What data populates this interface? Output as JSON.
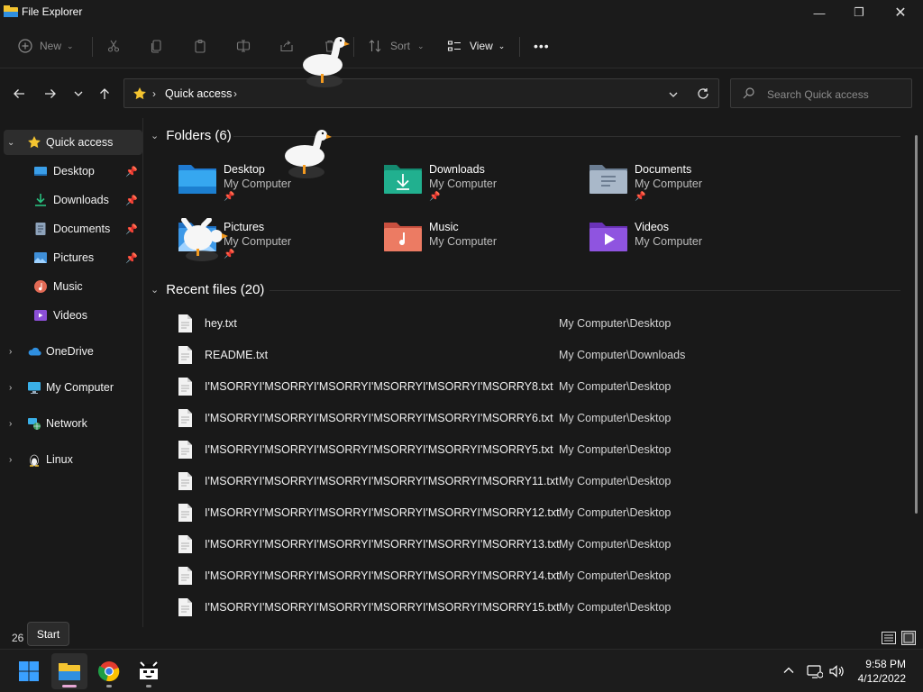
{
  "window": {
    "title": "File Explorer",
    "controls": {
      "minimize": "—",
      "maximize": "❐",
      "close": "✕"
    }
  },
  "commandbar": {
    "new_label": "New",
    "sort_label": "Sort",
    "view_label": "View",
    "more_label": "•••"
  },
  "address": {
    "chevron": "›",
    "location": "Quick access",
    "trailing_chevron": "›",
    "search_placeholder": "Search Quick access"
  },
  "sidebar": {
    "quick_access": "Quick access",
    "items": [
      {
        "label": "Desktop",
        "pinned": true,
        "icon": "desktop-icon"
      },
      {
        "label": "Downloads",
        "pinned": true,
        "icon": "downloads-icon"
      },
      {
        "label": "Documents",
        "pinned": true,
        "icon": "documents-icon"
      },
      {
        "label": "Pictures",
        "pinned": true,
        "icon": "pictures-icon"
      },
      {
        "label": "Music",
        "pinned": false,
        "icon": "music-icon"
      },
      {
        "label": "Videos",
        "pinned": false,
        "icon": "videos-icon"
      }
    ],
    "roots": [
      {
        "label": "OneDrive",
        "icon": "onedrive-icon"
      },
      {
        "label": "My Computer",
        "icon": "computer-icon"
      },
      {
        "label": "Network",
        "icon": "network-icon"
      },
      {
        "label": "Linux",
        "icon": "linux-icon"
      }
    ]
  },
  "folders": {
    "heading": "Folders (6)",
    "items": [
      {
        "name": "Desktop",
        "location": "My Computer",
        "pinned": true,
        "icon": "desktop-folder-icon"
      },
      {
        "name": "Downloads",
        "location": "My Computer",
        "pinned": true,
        "icon": "downloads-folder-icon"
      },
      {
        "name": "Documents",
        "location": "My Computer",
        "pinned": true,
        "icon": "documents-folder-icon"
      },
      {
        "name": "Pictures",
        "location": "My Computer",
        "pinned": true,
        "icon": "pictures-folder-icon"
      },
      {
        "name": "Music",
        "location": "My Computer",
        "pinned": false,
        "icon": "music-folder-icon"
      },
      {
        "name": "Videos",
        "location": "My Computer",
        "pinned": false,
        "icon": "videos-folder-icon"
      }
    ]
  },
  "recent": {
    "heading": "Recent files (20)",
    "files": [
      {
        "name": "hey.txt",
        "location": "My Computer\\Desktop"
      },
      {
        "name": "README.txt",
        "location": "My Computer\\Downloads"
      },
      {
        "name": "I'MSORRYI'MSORRYI'MSORRYI'MSORRYI'MSORRYI'MSORRY8.txt",
        "location": "My Computer\\Desktop"
      },
      {
        "name": "I'MSORRYI'MSORRYI'MSORRYI'MSORRYI'MSORRYI'MSORRY6.txt",
        "location": "My Computer\\Desktop"
      },
      {
        "name": "I'MSORRYI'MSORRYI'MSORRYI'MSORRYI'MSORRYI'MSORRY5.txt",
        "location": "My Computer\\Desktop"
      },
      {
        "name": "I'MSORRYI'MSORRYI'MSORRYI'MSORRYI'MSORRYI'MSORRY11.txt",
        "location": "My Computer\\Desktop"
      },
      {
        "name": "I'MSORRYI'MSORRYI'MSORRYI'MSORRYI'MSORRYI'MSORRY12.txt",
        "location": "My Computer\\Desktop"
      },
      {
        "name": "I'MSORRYI'MSORRYI'MSORRYI'MSORRYI'MSORRYI'MSORRY13.txt",
        "location": "My Computer\\Desktop"
      },
      {
        "name": "I'MSORRYI'MSORRYI'MSORRYI'MSORRYI'MSORRYI'MSORRY14.txt",
        "location": "My Computer\\Desktop"
      },
      {
        "name": "I'MSORRYI'MSORRYI'MSORRYI'MSORRYI'MSORRYI'MSORRY15.txt",
        "location": "My Computer\\Desktop"
      }
    ]
  },
  "statusbar": {
    "item_count": "26 i",
    "tooltip": "Start"
  },
  "taskbar": {
    "apps": [
      "start-icon",
      "file-explorer-icon",
      "chrome-icon",
      "goose-app-icon"
    ],
    "time": "9:58 PM",
    "date": "4/12/2022"
  },
  "colors": {
    "background": "#191919",
    "folder_blue": "#2f8fe0",
    "folder_teal": "#1fa88b",
    "accent_yellow": "#f4c430",
    "start_blue": "#3aa0ff"
  }
}
